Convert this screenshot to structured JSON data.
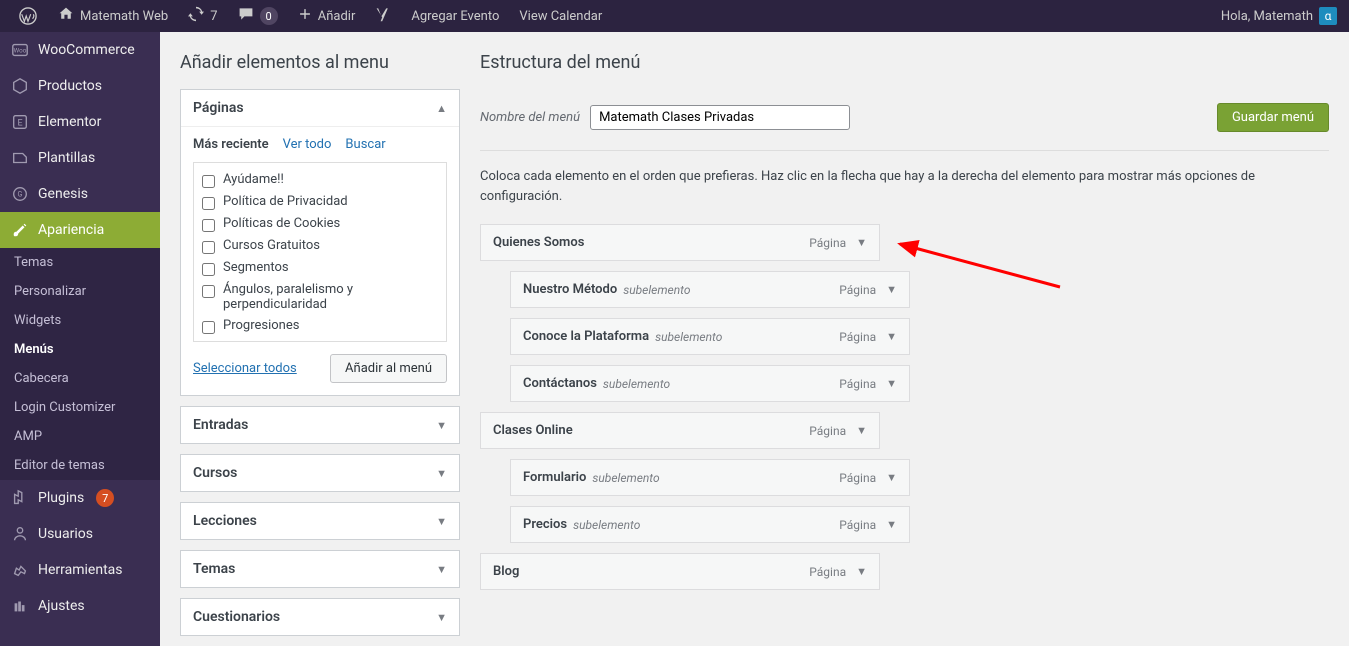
{
  "toolbar": {
    "site_name": "Matemath Web",
    "updates_count": "7",
    "comments_count": "",
    "add_label": "Añadir",
    "event_label": "Agregar Evento",
    "calendar_label": "View Calendar",
    "greeting": "Hola, Matemath"
  },
  "sidebar": {
    "items": [
      {
        "label": "WooCommerce"
      },
      {
        "label": "Productos"
      },
      {
        "label": "Elementor"
      },
      {
        "label": "Plantillas"
      },
      {
        "label": "Genesis"
      },
      {
        "label": "Apariencia"
      },
      {
        "label": "Plugins",
        "badge": "7"
      },
      {
        "label": "Usuarios"
      },
      {
        "label": "Herramientas"
      },
      {
        "label": "Ajustes"
      }
    ],
    "submenu": [
      {
        "label": "Temas"
      },
      {
        "label": "Personalizar"
      },
      {
        "label": "Widgets"
      },
      {
        "label": "Menús",
        "current": true
      },
      {
        "label": "Cabecera"
      },
      {
        "label": "Login Customizer"
      },
      {
        "label": "AMP"
      },
      {
        "label": "Editor de temas"
      }
    ]
  },
  "headings": {
    "left": "Añadir elementos al menu",
    "right": "Estructura del menú"
  },
  "pages_box": {
    "title": "Páginas",
    "tabs": {
      "recent": "Más reciente",
      "all": "Ver todo",
      "search": "Buscar"
    },
    "items": [
      "Ayúdame!!",
      "Política de Privacidad",
      "Políticas de Cookies",
      "Cursos Gratuitos",
      "Segmentos",
      "Ángulos, paralelismo y perpendicularidad",
      "Progresiones"
    ],
    "select_all": "Seleccionar todos",
    "add_btn": "Añadir al menú"
  },
  "accordions": [
    {
      "title": "Entradas"
    },
    {
      "title": "Cursos"
    },
    {
      "title": "Lecciones"
    },
    {
      "title": "Temas"
    },
    {
      "title": "Cuestionarios"
    }
  ],
  "menu_name": {
    "label": "Nombre del menú",
    "value": "Matemath Clases Privadas",
    "save": "Guardar menú"
  },
  "help_text": "Coloca cada elemento en el orden que prefieras. Haz clic en la flecha que hay a la derecha del elemento para mostrar más opciones de configuración.",
  "menu_items": [
    {
      "title": "Quienes Somos",
      "type": "Página",
      "indent": 0
    },
    {
      "title": "Nuestro Método",
      "sublabel": "subelemento",
      "type": "Página",
      "indent": 1
    },
    {
      "title": "Conoce la Plataforma",
      "sublabel": "subelemento",
      "type": "Página",
      "indent": 1
    },
    {
      "title": "Contáctanos",
      "sublabel": "subelemento",
      "type": "Página",
      "indent": 1
    },
    {
      "title": "Clases Online",
      "type": "Página",
      "indent": 0
    },
    {
      "title": "Formulario",
      "sublabel": "subelemento",
      "type": "Página",
      "indent": 1
    },
    {
      "title": "Precios",
      "sublabel": "subelemento",
      "type": "Página",
      "indent": 1
    },
    {
      "title": "Blog",
      "type": "Página",
      "indent": 0
    }
  ]
}
